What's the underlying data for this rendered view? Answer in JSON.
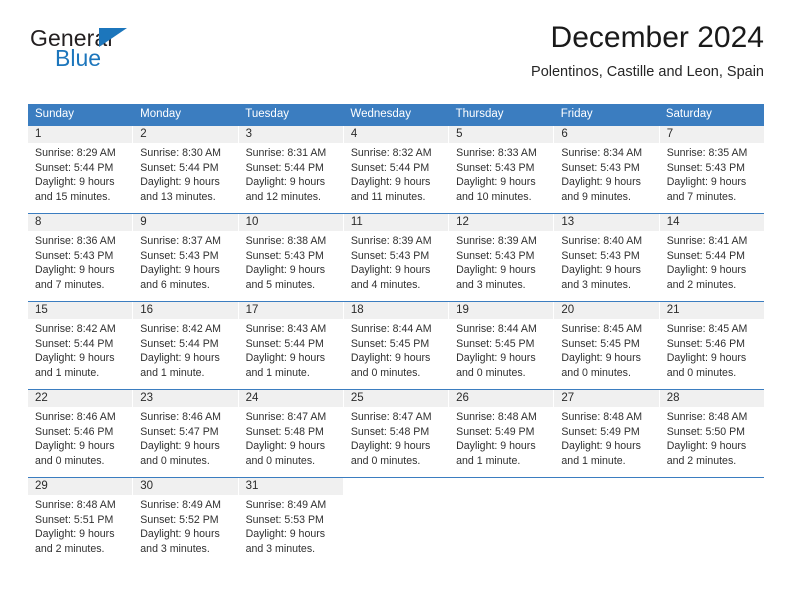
{
  "brand": {
    "word_general": "General",
    "word_blue": "Blue",
    "triangle_color": "#1c76bc",
    "text_color": "#231f20"
  },
  "header": {
    "title": "December 2024",
    "subtitle": "Polentinos, Castille and Leon, Spain"
  },
  "theme": {
    "header_blue": "#3b7dc0",
    "daynum_band": "#f0f0f0",
    "text": "#303030",
    "header_text": "#ffffff"
  },
  "weekdays": [
    "Sunday",
    "Monday",
    "Tuesday",
    "Wednesday",
    "Thursday",
    "Friday",
    "Saturday"
  ],
  "weeks": [
    [
      {
        "day": "1",
        "sunrise": "Sunrise: 8:29 AM",
        "sunset": "Sunset: 5:44 PM",
        "daylight1": "Daylight: 9 hours",
        "daylight2": "and 15 minutes."
      },
      {
        "day": "2",
        "sunrise": "Sunrise: 8:30 AM",
        "sunset": "Sunset: 5:44 PM",
        "daylight1": "Daylight: 9 hours",
        "daylight2": "and 13 minutes."
      },
      {
        "day": "3",
        "sunrise": "Sunrise: 8:31 AM",
        "sunset": "Sunset: 5:44 PM",
        "daylight1": "Daylight: 9 hours",
        "daylight2": "and 12 minutes."
      },
      {
        "day": "4",
        "sunrise": "Sunrise: 8:32 AM",
        "sunset": "Sunset: 5:44 PM",
        "daylight1": "Daylight: 9 hours",
        "daylight2": "and 11 minutes."
      },
      {
        "day": "5",
        "sunrise": "Sunrise: 8:33 AM",
        "sunset": "Sunset: 5:43 PM",
        "daylight1": "Daylight: 9 hours",
        "daylight2": "and 10 minutes."
      },
      {
        "day": "6",
        "sunrise": "Sunrise: 8:34 AM",
        "sunset": "Sunset: 5:43 PM",
        "daylight1": "Daylight: 9 hours",
        "daylight2": "and 9 minutes."
      },
      {
        "day": "7",
        "sunrise": "Sunrise: 8:35 AM",
        "sunset": "Sunset: 5:43 PM",
        "daylight1": "Daylight: 9 hours",
        "daylight2": "and 7 minutes."
      }
    ],
    [
      {
        "day": "8",
        "sunrise": "Sunrise: 8:36 AM",
        "sunset": "Sunset: 5:43 PM",
        "daylight1": "Daylight: 9 hours",
        "daylight2": "and 7 minutes."
      },
      {
        "day": "9",
        "sunrise": "Sunrise: 8:37 AM",
        "sunset": "Sunset: 5:43 PM",
        "daylight1": "Daylight: 9 hours",
        "daylight2": "and 6 minutes."
      },
      {
        "day": "10",
        "sunrise": "Sunrise: 8:38 AM",
        "sunset": "Sunset: 5:43 PM",
        "daylight1": "Daylight: 9 hours",
        "daylight2": "and 5 minutes."
      },
      {
        "day": "11",
        "sunrise": "Sunrise: 8:39 AM",
        "sunset": "Sunset: 5:43 PM",
        "daylight1": "Daylight: 9 hours",
        "daylight2": "and 4 minutes."
      },
      {
        "day": "12",
        "sunrise": "Sunrise: 8:39 AM",
        "sunset": "Sunset: 5:43 PM",
        "daylight1": "Daylight: 9 hours",
        "daylight2": "and 3 minutes."
      },
      {
        "day": "13",
        "sunrise": "Sunrise: 8:40 AM",
        "sunset": "Sunset: 5:43 PM",
        "daylight1": "Daylight: 9 hours",
        "daylight2": "and 3 minutes."
      },
      {
        "day": "14",
        "sunrise": "Sunrise: 8:41 AM",
        "sunset": "Sunset: 5:44 PM",
        "daylight1": "Daylight: 9 hours",
        "daylight2": "and 2 minutes."
      }
    ],
    [
      {
        "day": "15",
        "sunrise": "Sunrise: 8:42 AM",
        "sunset": "Sunset: 5:44 PM",
        "daylight1": "Daylight: 9 hours",
        "daylight2": "and 1 minute."
      },
      {
        "day": "16",
        "sunrise": "Sunrise: 8:42 AM",
        "sunset": "Sunset: 5:44 PM",
        "daylight1": "Daylight: 9 hours",
        "daylight2": "and 1 minute."
      },
      {
        "day": "17",
        "sunrise": "Sunrise: 8:43 AM",
        "sunset": "Sunset: 5:44 PM",
        "daylight1": "Daylight: 9 hours",
        "daylight2": "and 1 minute."
      },
      {
        "day": "18",
        "sunrise": "Sunrise: 8:44 AM",
        "sunset": "Sunset: 5:45 PM",
        "daylight1": "Daylight: 9 hours",
        "daylight2": "and 0 minutes."
      },
      {
        "day": "19",
        "sunrise": "Sunrise: 8:44 AM",
        "sunset": "Sunset: 5:45 PM",
        "daylight1": "Daylight: 9 hours",
        "daylight2": "and 0 minutes."
      },
      {
        "day": "20",
        "sunrise": "Sunrise: 8:45 AM",
        "sunset": "Sunset: 5:45 PM",
        "daylight1": "Daylight: 9 hours",
        "daylight2": "and 0 minutes."
      },
      {
        "day": "21",
        "sunrise": "Sunrise: 8:45 AM",
        "sunset": "Sunset: 5:46 PM",
        "daylight1": "Daylight: 9 hours",
        "daylight2": "and 0 minutes."
      }
    ],
    [
      {
        "day": "22",
        "sunrise": "Sunrise: 8:46 AM",
        "sunset": "Sunset: 5:46 PM",
        "daylight1": "Daylight: 9 hours",
        "daylight2": "and 0 minutes."
      },
      {
        "day": "23",
        "sunrise": "Sunrise: 8:46 AM",
        "sunset": "Sunset: 5:47 PM",
        "daylight1": "Daylight: 9 hours",
        "daylight2": "and 0 minutes."
      },
      {
        "day": "24",
        "sunrise": "Sunrise: 8:47 AM",
        "sunset": "Sunset: 5:48 PM",
        "daylight1": "Daylight: 9 hours",
        "daylight2": "and 0 minutes."
      },
      {
        "day": "25",
        "sunrise": "Sunrise: 8:47 AM",
        "sunset": "Sunset: 5:48 PM",
        "daylight1": "Daylight: 9 hours",
        "daylight2": "and 0 minutes."
      },
      {
        "day": "26",
        "sunrise": "Sunrise: 8:48 AM",
        "sunset": "Sunset: 5:49 PM",
        "daylight1": "Daylight: 9 hours",
        "daylight2": "and 1 minute."
      },
      {
        "day": "27",
        "sunrise": "Sunrise: 8:48 AM",
        "sunset": "Sunset: 5:49 PM",
        "daylight1": "Daylight: 9 hours",
        "daylight2": "and 1 minute."
      },
      {
        "day": "28",
        "sunrise": "Sunrise: 8:48 AM",
        "sunset": "Sunset: 5:50 PM",
        "daylight1": "Daylight: 9 hours",
        "daylight2": "and 2 minutes."
      }
    ],
    [
      {
        "day": "29",
        "sunrise": "Sunrise: 8:48 AM",
        "sunset": "Sunset: 5:51 PM",
        "daylight1": "Daylight: 9 hours",
        "daylight2": "and 2 minutes."
      },
      {
        "day": "30",
        "sunrise": "Sunrise: 8:49 AM",
        "sunset": "Sunset: 5:52 PM",
        "daylight1": "Daylight: 9 hours",
        "daylight2": "and 3 minutes."
      },
      {
        "day": "31",
        "sunrise": "Sunrise: 8:49 AM",
        "sunset": "Sunset: 5:53 PM",
        "daylight1": "Daylight: 9 hours",
        "daylight2": "and 3 minutes."
      },
      {
        "day": "",
        "sunrise": "",
        "sunset": "",
        "daylight1": "",
        "daylight2": ""
      },
      {
        "day": "",
        "sunrise": "",
        "sunset": "",
        "daylight1": "",
        "daylight2": ""
      },
      {
        "day": "",
        "sunrise": "",
        "sunset": "",
        "daylight1": "",
        "daylight2": ""
      },
      {
        "day": "",
        "sunrise": "",
        "sunset": "",
        "daylight1": "",
        "daylight2": ""
      }
    ]
  ]
}
